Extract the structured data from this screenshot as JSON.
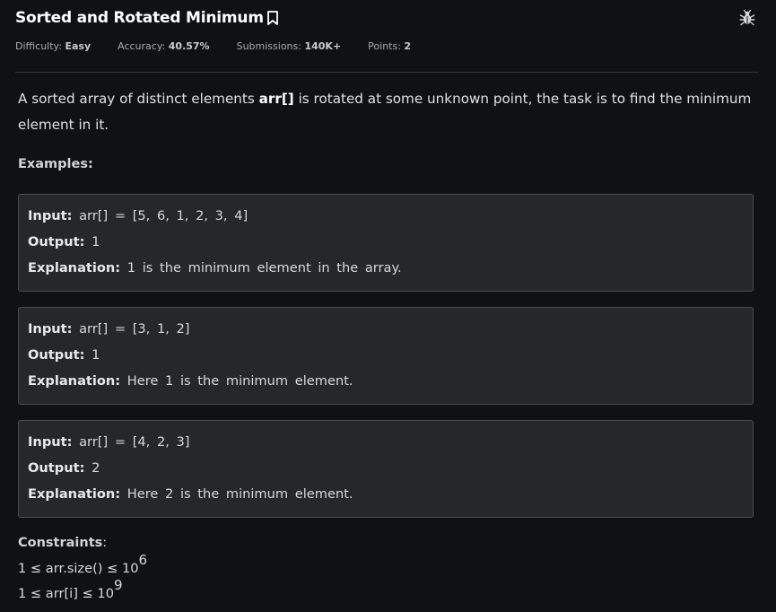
{
  "problem": {
    "title": "Sorted and Rotated Minimum",
    "meta": {
      "difficulty_label": "Difficulty:",
      "difficulty_value": "Easy",
      "accuracy_label": "Accuracy:",
      "accuracy_value": "40.57%",
      "submissions_label": "Submissions:",
      "submissions_value": "140K+",
      "points_label": "Points:",
      "points_value": "2"
    },
    "description": {
      "before": "A sorted array of distinct elements ",
      "highlight": "arr[]",
      "after": " is rotated at some unknown point, the task is to find the minimum element in it."
    },
    "examples_heading": "Examples:",
    "examples": [
      {
        "input_label": "Input:",
        "input_value": "arr[] = [5, 6, 1, 2, 3, 4]",
        "output_label": "Output:",
        "output_value": "1",
        "explanation_label": "Explanation:",
        "explanation_value": "1 is the minimum element in the array."
      },
      {
        "input_label": "Input:",
        "input_value": "arr[] = [3, 1, 2]",
        "output_label": "Output:",
        "output_value": "1",
        "explanation_label": "Explanation:",
        "explanation_value": "Here 1 is the minimum element."
      },
      {
        "input_label": "Input:",
        "input_value": "arr[] = [4, 2, 3]",
        "output_label": "Output:",
        "output_value": "2",
        "explanation_label": "Explanation:",
        "explanation_value": "Here 2 is the minimum element."
      }
    ],
    "constraints_heading": "Constraints",
    "constraints_colon": ":",
    "constraints": [
      {
        "text": "1 ≤ arr.size() ≤ 10",
        "exponent": "6"
      },
      {
        "text": "1 ≤ arr[i] ≤ 10",
        "exponent": "9"
      }
    ]
  },
  "icons": {
    "bookmark": "bookmark-icon",
    "bug": "bug-icon"
  },
  "colors": {
    "background": "#0f1214",
    "example_box": "#252729",
    "example_border": "#4a4e51"
  }
}
